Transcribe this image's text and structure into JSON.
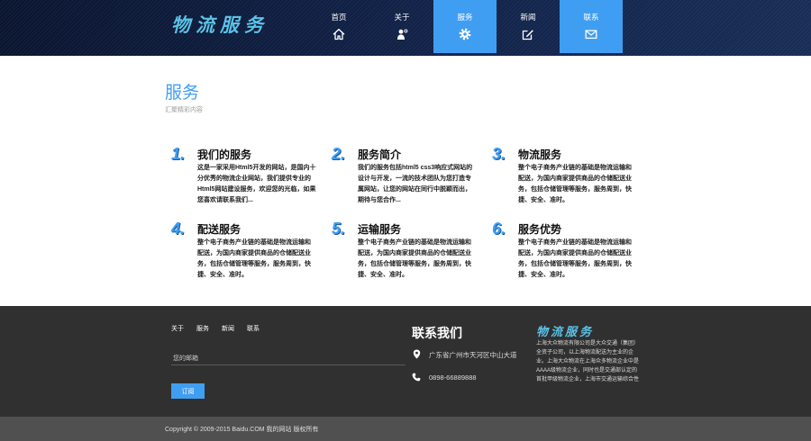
{
  "colors": {
    "accent": "#409ef2",
    "header_bg": "#12234a",
    "footer_bg": "#303030",
    "bottom_bar_bg": "#505050",
    "logo": "#5cc2e8"
  },
  "header": {
    "logo": "物流服务",
    "nav": [
      {
        "label": "首页",
        "icon": "home-icon",
        "selected": false
      },
      {
        "label": "关于",
        "icon": "user-icon",
        "selected": false
      },
      {
        "label": "服务",
        "icon": "gear-icon",
        "selected": true
      },
      {
        "label": "新闻",
        "icon": "edit-icon",
        "selected": false
      },
      {
        "label": "联系",
        "icon": "envelope-icon",
        "selected": true
      }
    ]
  },
  "main": {
    "title": "服务",
    "subtitle": "汇聚精彩内容",
    "services": [
      {
        "number": "1.",
        "title": "我们的服务",
        "text": "这是一家采用Html5开发的网站，是国内十分优秀的物流企业网站，我们提供专业的Html5网站建设服务，欢迎您的光临，如果您喜欢请联系我们..."
      },
      {
        "number": "2.",
        "title": "服务简介",
        "text": "我们的服务包括html5 css3响应式网站的设计与开发，一流的技术团队为您打造专属网站，让您的网站在同行中脱颖而出，期待与您合作..."
      },
      {
        "number": "3.",
        "title": "物流服务",
        "text": "整个电子商务产业链的基础是物流运输和配送，为国内商家提供商品的仓储配送业务，包括仓储管理等服务，服务周到，快捷、安全、准时。"
      },
      {
        "number": "4.",
        "title": "配送服务",
        "text": "整个电子商务产业链的基础是物流运输和配送，为国内商家提供商品的仓储配送业务，包括仓储管理等服务，服务周到，快捷、安全、准时。"
      },
      {
        "number": "5.",
        "title": "运输服务",
        "text": "整个电子商务产业链的基础是物流运输和配送，为国内商家提供商品的仓储配送业务，包括仓储管理等服务，服务周到，快捷、安全、准时。"
      },
      {
        "number": "6.",
        "title": "服务优势",
        "text": "整个电子商务产业链的基础是物流运输和配送，为国内商家提供商品的仓储配送业务，包括仓储管理等服务，服务周到，快捷、安全、准时。"
      }
    ]
  },
  "footer": {
    "links": [
      "关于",
      "服务",
      "新闻",
      "联系"
    ],
    "email_placeholder": "您的邮箱",
    "subscribe_label": "订阅",
    "contact_title": "联系我们",
    "address": "广东省广州市天河区中山大道",
    "phone": "0898-66889888",
    "logo": "物流服务",
    "about": "上海大众物流有限公司是大众交通（集团）全资子公司，以上海物流配送为主业的企业。上海大众物流在上海众多物流企业中是AAAA级物流企业，同时也是交通部认定的首批甲级物流企业，上海市交通运输综合性服务企业。"
  },
  "copyright": "Copyright © 2009-2015 Baidu.COM 我的网站 版权所有"
}
